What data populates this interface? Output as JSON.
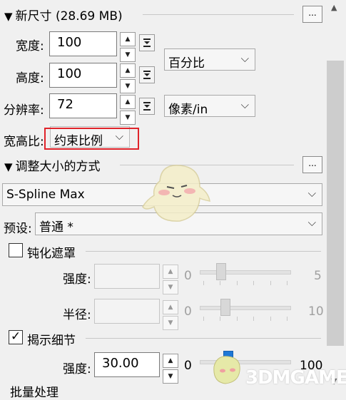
{
  "new_size": {
    "title": "新尺寸 (28.69 MB)",
    "more_label": "...",
    "width_label": "宽度:",
    "width_value": "100",
    "height_label": "高度:",
    "height_value": "100",
    "resolution_label": "分辨率:",
    "resolution_value": "72",
    "size_unit": "百分比",
    "resolution_unit": "像素/in",
    "aspect_label": "宽高比:",
    "aspect_value": "约束比例"
  },
  "resize_method": {
    "title": "调整大小的方式",
    "more_label": "...",
    "algorithm": "S-Spline Max",
    "preset_label": "预设:",
    "preset_value": "普通 *"
  },
  "blur_mask": {
    "title": "钝化遮罩",
    "checked": false,
    "strength_label": "强度:",
    "strength_min": "0",
    "strength_max": "5",
    "radius_label": "半径:",
    "radius_min": "0",
    "radius_max": "10"
  },
  "reveal_detail": {
    "title": "揭示细节",
    "checked": true,
    "check_mark": "✓",
    "strength_label": "强度:",
    "strength_value": "30.00",
    "strength_min": "0",
    "strength_max": "100"
  },
  "batch": {
    "title": "批量处理"
  },
  "watermark": {
    "text": "3DMGAME"
  },
  "colors": {
    "highlight": "#e0232a",
    "slider_accent": "#1e78d6"
  }
}
